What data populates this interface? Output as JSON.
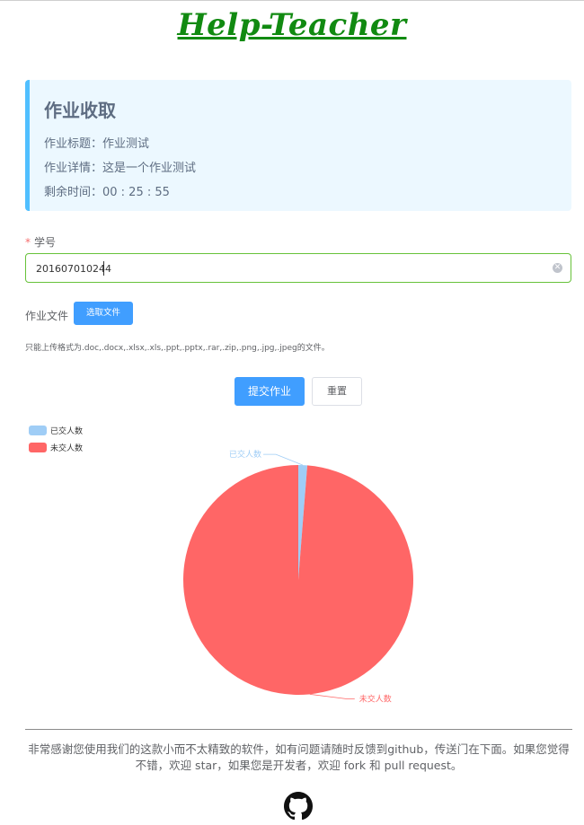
{
  "site": {
    "title": "Help-Teacher"
  },
  "assignment": {
    "heading": "作业收取",
    "title_line": "作业标题：作业测试",
    "detail_line": "作业详情：这是一个作业测试",
    "remaining_line": "剩余时间：00 : 25 : 55"
  },
  "form": {
    "student_id": {
      "required_mark": "*",
      "label": "学号",
      "value": "201607010244"
    },
    "file": {
      "label": "作业文件",
      "select_button": "选取文件",
      "tip": "只能上传格式为.doc,.docx,.xlsx,.xls,.ppt,.pptx,.rar,.zip,.png,.jpg,.jpeg的文件。"
    },
    "submit_button": "提交作业",
    "reset_button": "重置"
  },
  "chart_data": {
    "type": "pie",
    "series": [
      {
        "name": "已交人数",
        "value": 1,
        "color": "#9fcdf6"
      },
      {
        "name": "未交人数",
        "value": 79,
        "color": "#ff6666"
      }
    ],
    "legend_placement": "top-left"
  },
  "footer": {
    "text": "非常感谢您使用我们的这款小而不太精致的软件，如有问题请随时反馈到github，传送门在下面。如果您觉得不错，欢迎 star，如果您是开发者，欢迎 fork 和 pull request。",
    "icon": "github-icon"
  }
}
